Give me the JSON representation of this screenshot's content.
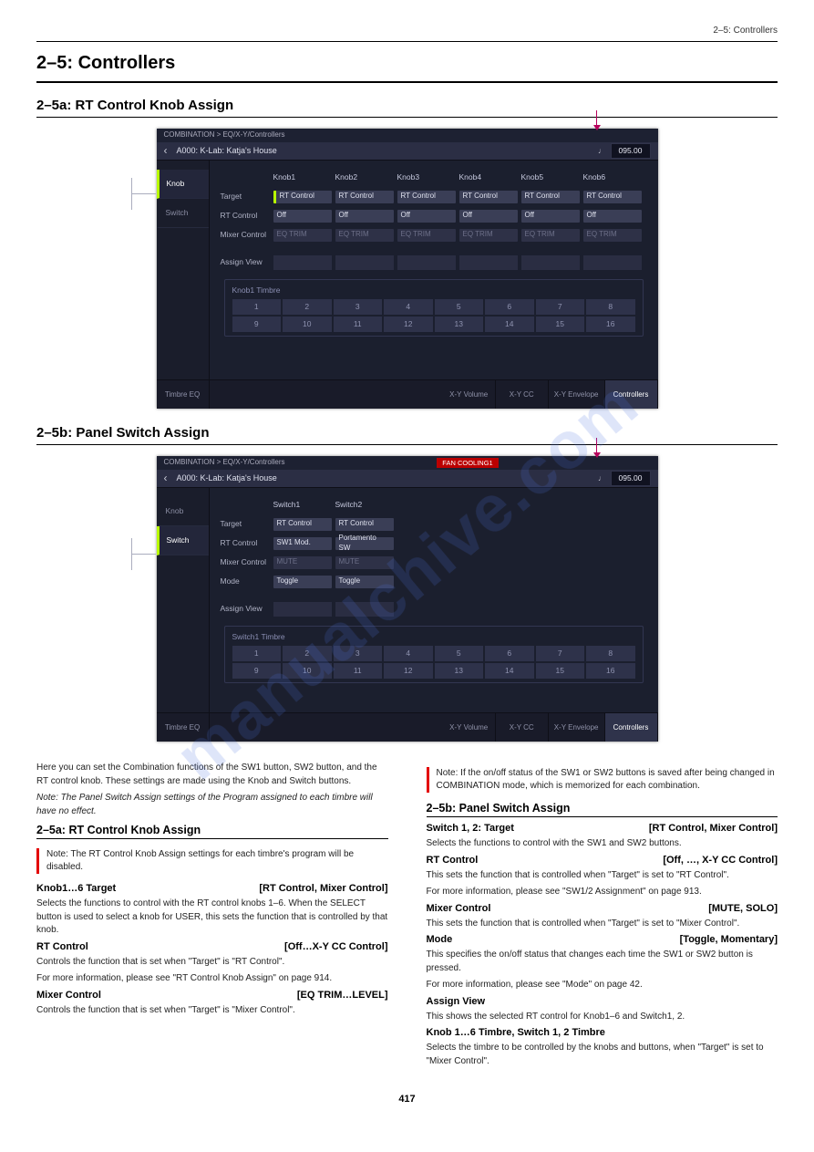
{
  "domain": "Document",
  "page_header": "2–5: Controllers",
  "section_title": "2–5: Controllers",
  "knob_subtitle": "2–5a: RT Control Knob Assign",
  "switch_subtitle": "2–5b: Panel Switch Assign",
  "watermark": "manualchive.com",
  "ui_knob": {
    "breadcrumb": "COMBINATION > EQ/X-Y/Controllers",
    "title": "A000: K-Lab: Katja's House",
    "tempo_icon": "♩",
    "tempo": "095.00",
    "side": {
      "knob": "Knob",
      "switch": "Switch"
    },
    "headers": [
      "Knob1",
      "Knob2",
      "Knob3",
      "Knob4",
      "Knob5",
      "Knob6"
    ],
    "row_target_label": "Target",
    "row_target": [
      "RT Control",
      "RT Control",
      "RT Control",
      "RT Control",
      "RT Control",
      "RT Control"
    ],
    "row_rt_label": "RT Control",
    "row_rt": [
      "Off",
      "Off",
      "Off",
      "Off",
      "Off",
      "Off"
    ],
    "row_mix_label": "Mixer Control",
    "row_mix": [
      "EQ TRIM",
      "EQ TRIM",
      "EQ TRIM",
      "EQ TRIM",
      "EQ TRIM",
      "EQ TRIM"
    ],
    "assign_label": "Assign View",
    "timbre_title": "Knob1 Timbre",
    "timbres_top": [
      "1",
      "2",
      "3",
      "4",
      "5",
      "6",
      "7",
      "8"
    ],
    "timbres_bot": [
      "9",
      "10",
      "11",
      "12",
      "13",
      "14",
      "15",
      "16"
    ],
    "bottom_tabs": [
      "Timbre EQ",
      "X-Y Volume",
      "X-Y CC",
      "X-Y Envelope",
      "Controllers"
    ]
  },
  "ui_switch": {
    "breadcrumb": "COMBINATION > EQ/X-Y/Controllers",
    "notice": "FAN COOLING1",
    "title": "A000: K-Lab: Katja's House",
    "tempo_icon": "♩",
    "tempo": "095.00",
    "side": {
      "knob": "Knob",
      "switch": "Switch"
    },
    "headers": [
      "Switch1",
      "Switch2"
    ],
    "row_target_label": "Target",
    "row_target": [
      "RT Control",
      "RT Control"
    ],
    "row_rt_label": "RT Control",
    "row_rt": [
      "SW1 Mod.",
      "Portamento SW"
    ],
    "row_mix_label": "Mixer Control",
    "row_mix": [
      "MUTE",
      "MUTE"
    ],
    "row_mode_label": "Mode",
    "row_mode": [
      "Toggle",
      "Toggle"
    ],
    "assign_label": "Assign View",
    "timbre_title": "Switch1 Timbre",
    "timbres_top": [
      "1",
      "2",
      "3",
      "4",
      "5",
      "6",
      "7",
      "8"
    ],
    "timbres_bot": [
      "9",
      "10",
      "11",
      "12",
      "13",
      "14",
      "15",
      "16"
    ],
    "bottom_tabs": [
      "Timbre EQ",
      "X-Y Volume",
      "X-Y CC",
      "X-Y Envelope",
      "Controllers"
    ]
  },
  "col_left": {
    "intro": "Here you can set the Combination functions of the SW1 button, SW2 button, and the RT control knob. These settings are made using the Knob and Switch buttons.",
    "note": "Note: The Panel Switch Assign settings of the Program assigned to each timbre will have no effect.",
    "red1": "Note: The RT Control Knob Assign settings for each timbre's program will be disabled.",
    "knob_target": {
      "label": "Knob1…6 Target",
      "range": "[RT Control, Mixer Control]",
      "body": "Selects the functions to control with the RT control knobs 1–6. When the SELECT button is used to select a knob for USER, this sets the function that is controlled by that knob."
    },
    "rt_control": {
      "label": "RT Control",
      "range": "[Off…X-Y CC Control]",
      "body1": "Controls the function that is set when \"Target\" is \"RT Control\".",
      "body2": "For more information, please see \"RT Control Knob Assign\" on page 914."
    },
    "mixer_control": {
      "label": "Mixer Control",
      "range": "[EQ TRIM…LEVEL]",
      "body": "Controls the function that is set when \"Target\" is \"Mixer Control\"."
    }
  },
  "col_right": {
    "red2": "Note: If the on/off status of the SW1 or SW2 buttons is saved after being changed in COMBINATION mode, which is memorized for each combination.",
    "sw_target": {
      "label": "Switch 1, 2: Target",
      "range": "[RT Control, Mixer Control]",
      "body": "Selects the functions to control with the SW1 and SW2 buttons."
    },
    "sw_rt": {
      "label": "RT Control",
      "range": "[Off, …, X-Y CC Control]",
      "body1": "This sets the function that is controlled when \"Target\" is set to \"RT Control\".",
      "body2": "For more information, please see \"SW1/2 Assignment\" on page 913."
    },
    "sw_mix": {
      "label": "Mixer Control",
      "range": "[MUTE, SOLO]",
      "body": "This sets the function that is controlled when \"Target\" is set to \"Mixer Control\"."
    },
    "sw_mode": {
      "label": "Mode",
      "range": "[Toggle, Momentary]",
      "body1": "This specifies the on/off status that changes each time the SW1 or SW2 button is pressed.",
      "body2": "For more information, please see \"Mode\" on page 42."
    },
    "assign_label": "Assign View",
    "assign_body": "This shows the selected RT control for Knob1–6 and Switch1, 2.",
    "timbre_label": "Knob 1…6 Timbre, Switch 1, 2 Timbre",
    "timbre_body": "Selects the timbre to be controlled by the knobs and buttons, when \"Target\" is set to \"Mixer Control\"."
  },
  "page_number": "417"
}
